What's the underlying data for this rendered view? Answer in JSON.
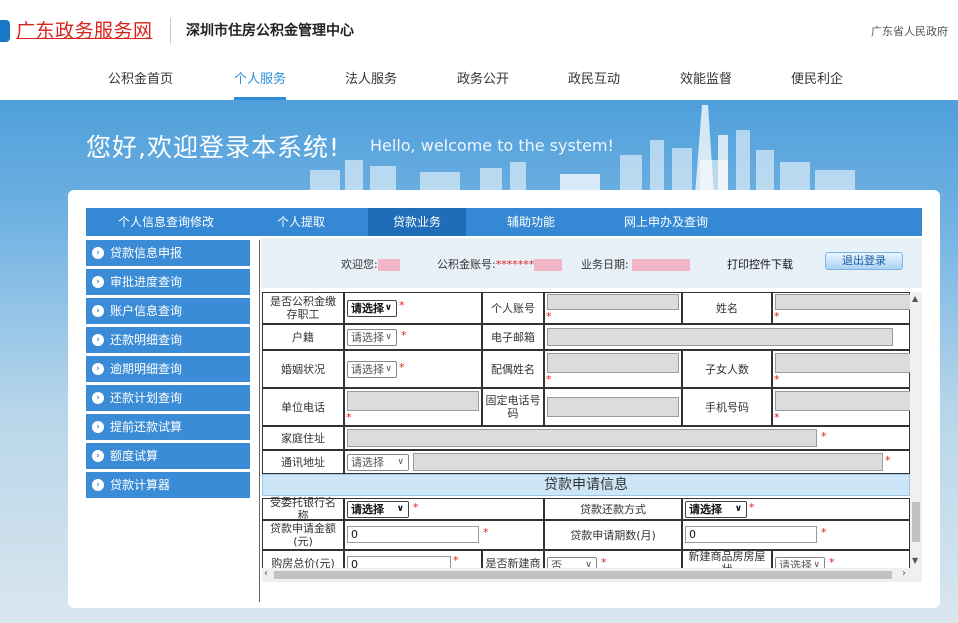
{
  "header": {
    "brand": "广东政务服务网",
    "center_name": "深圳市住房公积金管理中心",
    "gov_link": "广东省人民政府"
  },
  "main_nav": [
    {
      "label": "公积金首页",
      "active": false
    },
    {
      "label": "个人服务",
      "active": true
    },
    {
      "label": "法人服务",
      "active": false
    },
    {
      "label": "政务公开",
      "active": false
    },
    {
      "label": "政民互动",
      "active": false
    },
    {
      "label": "效能监督",
      "active": false
    },
    {
      "label": "便民利企",
      "active": false
    }
  ],
  "banner": {
    "welcome": "您好,欢迎登录本系统!",
    "welcome_en": "Hello, welcome to the system!"
  },
  "sub_nav": [
    {
      "label": "个人信息查询修改",
      "active": false
    },
    {
      "label": "个人提取",
      "active": false
    },
    {
      "label": "贷款业务",
      "active": true
    },
    {
      "label": "辅助功能",
      "active": false
    },
    {
      "label": "网上申办及查询",
      "active": false
    }
  ],
  "sidebar": [
    "贷款信息申报",
    "审批进度查询",
    "账户信息查询",
    "还款明细查询",
    "逾期明细查询",
    "还款计划查询",
    "提前还款试算",
    "额度试算",
    "贷款计算器"
  ],
  "info_bar": {
    "welcome_label": "欢迎您:",
    "account_label": "公积金账号:",
    "account_value": "*******",
    "date_label": "业务日期:",
    "print_download": "打印控件下载",
    "logout": "退出登录"
  },
  "form": {
    "required_mark": "*",
    "select_placeholder": "请选择",
    "labels": {
      "is_depositor": "是否公积金缴存职工",
      "personal_account": "个人账号",
      "name": "姓名",
      "household": "户籍",
      "email": "电子邮箱",
      "marital": "婚姻状况",
      "spouse_name": "配偶姓名",
      "children": "子女人数",
      "work_phone": "单位电话",
      "fixed_phone": "固定电话号码",
      "mobile": "手机号码",
      "home_address": "家庭住址",
      "mailing_address": "通讯地址",
      "bank_name": "受委托银行名称",
      "repay_method": "贷款还款方式",
      "loan_amount": "贷款申请金额(元)",
      "loan_term": "贷款申请期数(月)",
      "house_price": "购房总价(元)",
      "is_new_house": "是否新建商",
      "new_house_status": "新建商品房房屋状"
    },
    "loan_section_title": "贷款申请信息",
    "loan_amount_value": "0",
    "loan_term_value": "0",
    "house_price_value": "0",
    "is_new_house_value": "否"
  },
  "colors": {
    "brand_red": "#d8231d",
    "nav_blue": "#3488d4",
    "active_tab": "#2d8fd9",
    "required_red": "#e01c1c"
  }
}
